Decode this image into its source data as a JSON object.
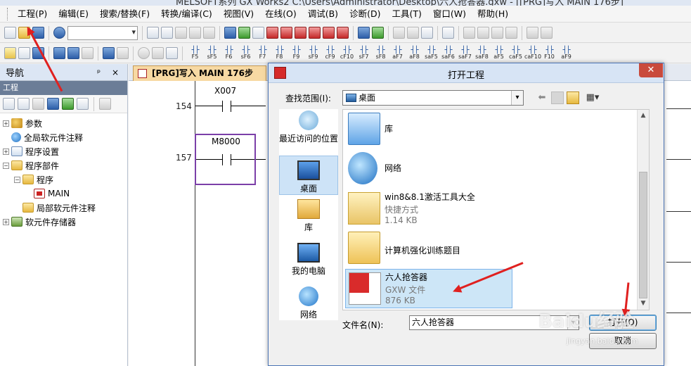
{
  "window": {
    "title": "MELSOFT系列 GX Works2 C:\\Users\\Administrator\\Desktop\\六人抢答器.gxw - [[PRG]写入 MAIN 176步]"
  },
  "menu": [
    "工程(P)",
    "编辑(E)",
    "搜索/替换(F)",
    "转换/编译(C)",
    "视图(V)",
    "在线(O)",
    "调试(B)",
    "诊断(D)",
    "工具(T)",
    "窗口(W)",
    "帮助(H)"
  ],
  "toolbar3_keys": [
    {
      "top": "F5",
      "bot": ""
    },
    {
      "top": "sF5",
      "bot": ""
    },
    {
      "top": "F6",
      "bot": ""
    },
    {
      "top": "sF6",
      "bot": ""
    },
    {
      "top": "F7",
      "bot": ""
    },
    {
      "top": "F8",
      "bot": ""
    },
    {
      "top": "F9",
      "bot": ""
    },
    {
      "top": "sF9",
      "bot": ""
    },
    {
      "top": "cF9",
      "bot": ""
    },
    {
      "top": "cF10",
      "bot": ""
    },
    {
      "top": "sF7",
      "bot": ""
    },
    {
      "top": "sF8",
      "bot": ""
    },
    {
      "top": "aF7",
      "bot": ""
    },
    {
      "top": "aF8",
      "bot": ""
    },
    {
      "top": "saF5",
      "bot": ""
    },
    {
      "top": "saF6",
      "bot": ""
    },
    {
      "top": "saF7",
      "bot": ""
    },
    {
      "top": "saF8",
      "bot": ""
    },
    {
      "top": "aF5",
      "bot": ""
    },
    {
      "top": "caF5",
      "bot": ""
    },
    {
      "top": "caF10",
      "bot": ""
    },
    {
      "top": "F10",
      "bot": ""
    },
    {
      "top": "aF9",
      "bot": ""
    }
  ],
  "nav": {
    "title": "导航",
    "pin": "ᵖ ×",
    "section": "工程",
    "tree": [
      {
        "label": "参数",
        "indent": 0,
        "toggle": "+",
        "icon": "param"
      },
      {
        "label": "全局软元件注释",
        "indent": 0,
        "toggle": "",
        "icon": "globe"
      },
      {
        "label": "程序设置",
        "indent": 0,
        "toggle": "+",
        "icon": "prog"
      },
      {
        "label": "程序部件",
        "indent": 0,
        "toggle": "−",
        "icon": "folder"
      },
      {
        "label": "程序",
        "indent": 1,
        "toggle": "−",
        "icon": "folder"
      },
      {
        "label": "MAIN",
        "indent": 2,
        "toggle": "",
        "icon": "main"
      },
      {
        "label": "局部软元件注释",
        "indent": 1,
        "toggle": "",
        "icon": "folder"
      },
      {
        "label": "软元件存储器",
        "indent": 0,
        "toggle": "+",
        "icon": "mem"
      }
    ]
  },
  "editor": {
    "tab_label": "[PRG]写入 MAIN 176步",
    "rungs": [
      {
        "step": "154",
        "device": "X007"
      },
      {
        "step": "157",
        "device": "M8000"
      }
    ]
  },
  "dialog": {
    "title": "打开工程",
    "close": "✕",
    "lookin_label": "查找范围(I):",
    "lookin_value": "桌面",
    "places": [
      {
        "label": "最近访问的位置",
        "icon": "recent"
      },
      {
        "label": "桌面",
        "icon": "desktop"
      },
      {
        "label": "库",
        "icon": "lib"
      },
      {
        "label": "我的电脑",
        "icon": "pc"
      },
      {
        "label": "网络",
        "icon": "net"
      }
    ],
    "files": [
      {
        "name": "库",
        "sub1": "",
        "sub2": "",
        "icon": "libfolder"
      },
      {
        "name": "网络",
        "sub1": "",
        "sub2": "",
        "icon": "globe"
      },
      {
        "name": "win8&8.1激活工具大全",
        "sub1": "快捷方式",
        "sub2": "1.14 KB",
        "icon": "shortcut"
      },
      {
        "name": "计算机强化训练题目",
        "sub1": "",
        "sub2": "",
        "icon": "folder"
      },
      {
        "name": "六人抢答器",
        "sub1": "GXW 文件",
        "sub2": "876 KB",
        "icon": "gxw"
      }
    ],
    "filename_label": "文件名(N):",
    "filename_value": "六人抢答器",
    "open_button": "打开(O)",
    "cancel_button": "取消"
  },
  "watermark": {
    "brand": "Baidu经验",
    "url": "jingyan.baidu.com"
  },
  "colors": {
    "annotation_arrow": "#e0201f",
    "selection": "#cde6f7",
    "nav_header": "#dce6f4"
  }
}
